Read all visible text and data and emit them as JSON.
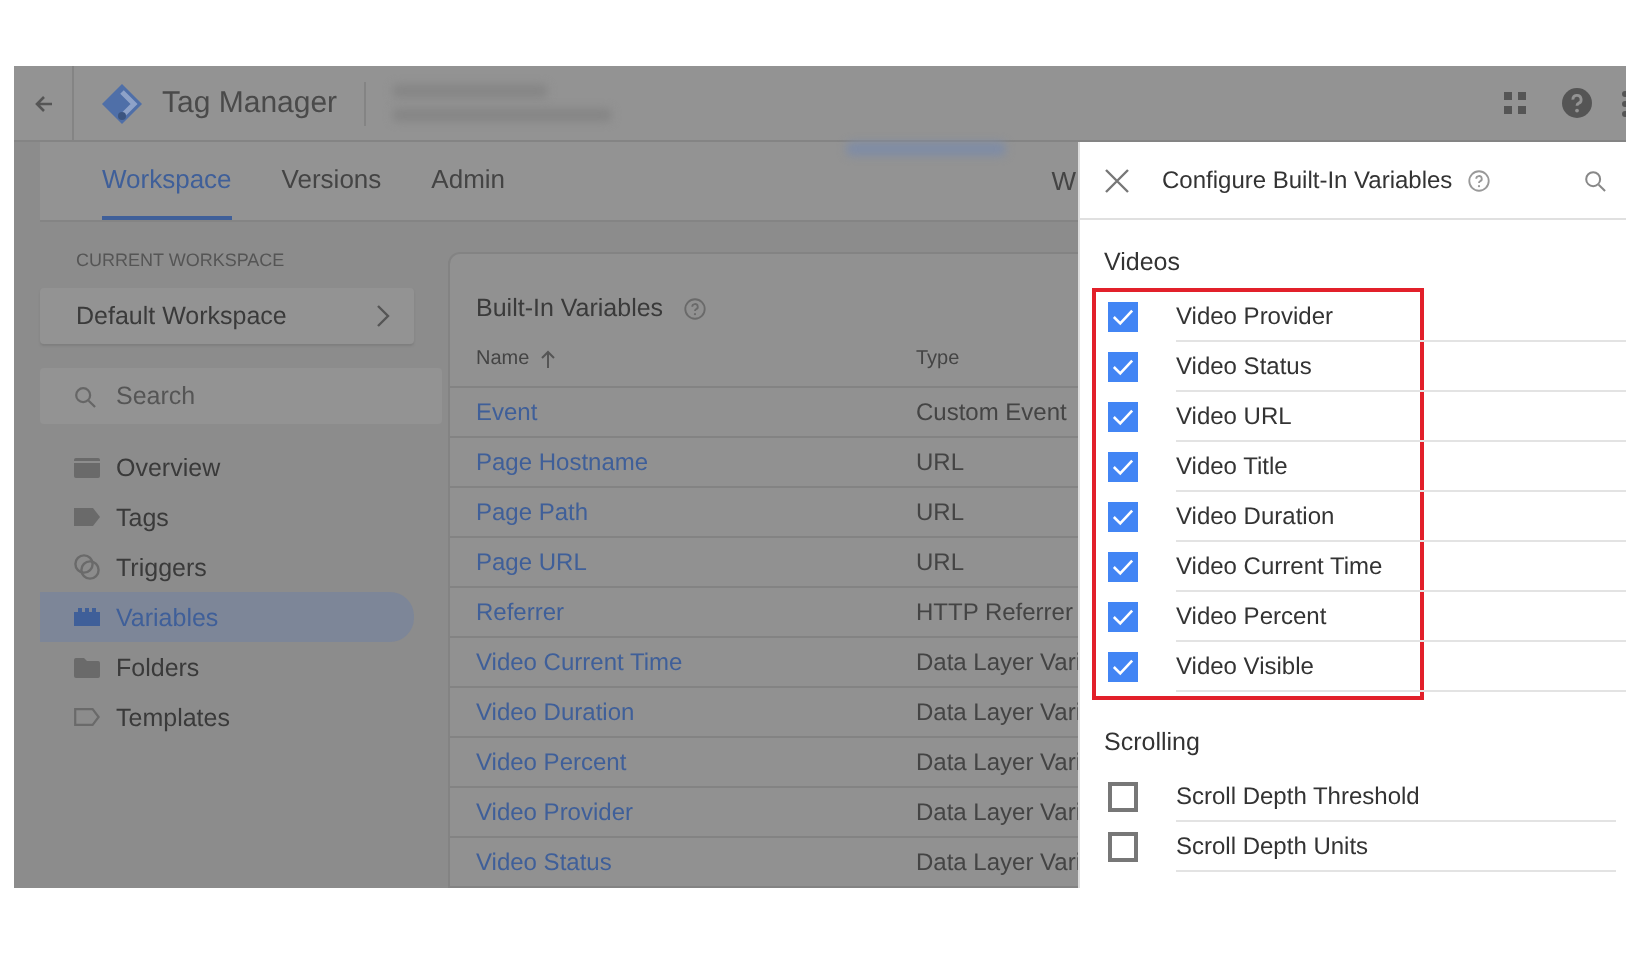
{
  "app": {
    "title": "Tag Manager"
  },
  "nav_tabs": [
    {
      "label": "Workspace",
      "selected": true
    },
    {
      "label": "Versions",
      "selected": false
    },
    {
      "label": "Admin",
      "selected": false
    }
  ],
  "nav_right": "W",
  "sidebar": {
    "section_label": "CURRENT WORKSPACE",
    "workspace": "Default Workspace",
    "search": {
      "placeholder": "Search"
    },
    "items": [
      {
        "label": "Overview",
        "kind": "overview",
        "selected": false
      },
      {
        "label": "Tags",
        "kind": "tags",
        "selected": false
      },
      {
        "label": "Triggers",
        "kind": "triggers",
        "selected": false
      },
      {
        "label": "Variables",
        "kind": "variables",
        "selected": true
      },
      {
        "label": "Folders",
        "kind": "folders",
        "selected": false
      },
      {
        "label": "Templates",
        "kind": "templates",
        "selected": false
      }
    ]
  },
  "table": {
    "title": "Built-In Variables",
    "columns": [
      {
        "label": "Name",
        "sorted": true
      },
      {
        "label": "Type",
        "sorted": false
      }
    ],
    "rows": [
      {
        "name": "Event",
        "type": "Custom Event"
      },
      {
        "name": "Page Hostname",
        "type": "URL"
      },
      {
        "name": "Page Path",
        "type": "URL"
      },
      {
        "name": "Page URL",
        "type": "URL"
      },
      {
        "name": "Referrer",
        "type": "HTTP Referrer"
      },
      {
        "name": "Video Current Time",
        "type": "Data Layer Vari"
      },
      {
        "name": "Video Duration",
        "type": "Data Layer Vari"
      },
      {
        "name": "Video Percent",
        "type": "Data Layer Vari"
      },
      {
        "name": "Video Provider",
        "type": "Data Layer Vari"
      },
      {
        "name": "Video Status",
        "type": "Data Layer Vari"
      }
    ]
  },
  "panel": {
    "title": "Configure Built-In Variables",
    "groups": [
      {
        "title": "Videos",
        "highlighted": true,
        "items": [
          {
            "label": "Video Provider",
            "checked": true
          },
          {
            "label": "Video Status",
            "checked": true
          },
          {
            "label": "Video URL",
            "checked": true
          },
          {
            "label": "Video Title",
            "checked": true
          },
          {
            "label": "Video Duration",
            "checked": true
          },
          {
            "label": "Video Current Time",
            "checked": true
          },
          {
            "label": "Video Percent",
            "checked": true
          },
          {
            "label": "Video Visible",
            "checked": true
          }
        ]
      },
      {
        "title": "Scrolling",
        "highlighted": false,
        "items": [
          {
            "label": "Scroll Depth Threshold",
            "checked": false
          },
          {
            "label": "Scroll Depth Units",
            "checked": false
          }
        ]
      }
    ]
  }
}
